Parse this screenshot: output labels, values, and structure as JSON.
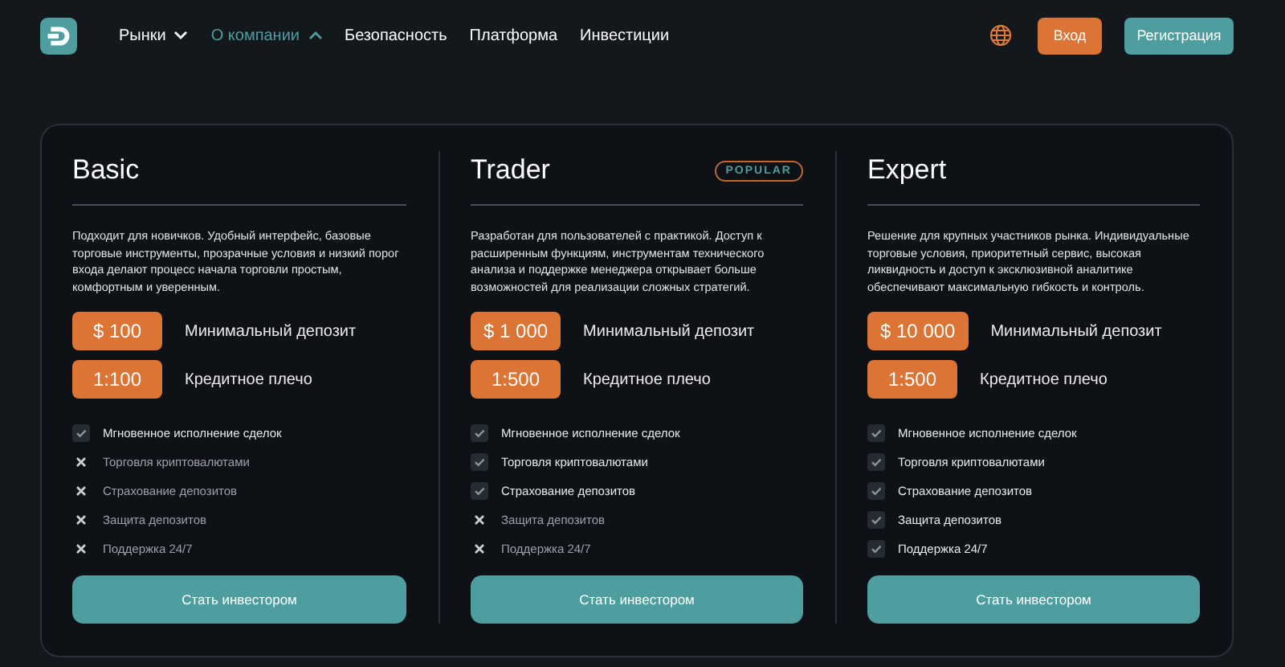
{
  "header": {
    "nav": [
      {
        "label": "Рынки",
        "kind": "dropdown",
        "selected": false,
        "expanded": false
      },
      {
        "label": "О компании",
        "kind": "dropdown",
        "selected": true,
        "expanded": true
      },
      {
        "label": "Безопасность",
        "kind": "link",
        "selected": false
      },
      {
        "label": "Платформа",
        "kind": "link",
        "selected": false
      },
      {
        "label": "Инвестиции",
        "kind": "link",
        "selected": false
      }
    ],
    "login_button": "Вход",
    "register_button": "Регистрация"
  },
  "plans": [
    {
      "name": "Basic",
      "description": "Подходит для новичков. Удобный интерфейс, базовые торговые инструменты, прозрачные условия и низкий порог входа делают процесс начала торговли простым, комфортным и уверенным.",
      "deposit": "$ 100",
      "deposit_label": "Минимальный депозит",
      "leverage": "1:100",
      "leverage_label": "Кредитное плечо",
      "features": [
        {
          "label": "Мгновенное исполнение сделок",
          "included": true
        },
        {
          "label": "Торговля криптовалютами",
          "included": false
        },
        {
          "label": "Страхование депозитов",
          "included": false
        },
        {
          "label": "Защита депозитов",
          "included": false
        },
        {
          "label": "Поддержка 24/7",
          "included": false
        }
      ],
      "button": "Стать инвестором"
    },
    {
      "name": "Trader",
      "badge": "POPULAR",
      "description": "Разработан для пользователей с практикой. Доступ к расширенным функциям, инструментам технического анализа и поддержке менеджера открывает больше возможностей для реализации сложных стратегий.",
      "deposit": "$ 1 000",
      "deposit_label": "Минимальный депозит",
      "leverage": "1:500",
      "leverage_label": "Кредитное плечо",
      "features": [
        {
          "label": "Мгновенное исполнение сделок",
          "included": true
        },
        {
          "label": "Торговля криптовалютами",
          "included": true
        },
        {
          "label": "Страхование депозитов",
          "included": true
        },
        {
          "label": "Защита депозитов",
          "included": false
        },
        {
          "label": "Поддержка 24/7",
          "included": false
        }
      ],
      "button": "Стать инвестором"
    },
    {
      "name": "Expert",
      "description": "Решение для крупных участников рынка. Индивидуальные торговые условия, приоритетный сервис, высокая ликвидность и доступ к эксклюзивной аналитике обеспечивают максимальную гибкость и контроль.",
      "deposit": "$ 10 000",
      "deposit_label": "Минимальный депозит",
      "leverage": "1:500",
      "leverage_label": "Кредитное плечо",
      "features": [
        {
          "label": "Мгновенное исполнение сделок",
          "included": true
        },
        {
          "label": "Торговля криптовалютами",
          "included": true
        },
        {
          "label": "Страхование депозитов",
          "included": true
        },
        {
          "label": "Защита депозитов",
          "included": true
        },
        {
          "label": "Поддержка 24/7",
          "included": true
        }
      ],
      "button": "Стать инвестором"
    }
  ]
}
